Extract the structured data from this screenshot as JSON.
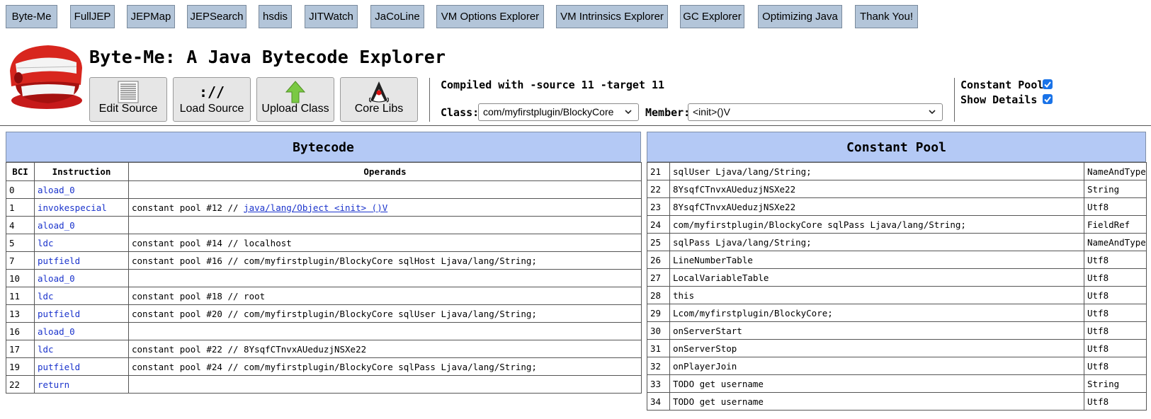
{
  "nav": {
    "items": [
      "Byte-Me",
      "FullJEP",
      "JEPMap",
      "JEPSearch",
      "hsdis",
      "JITWatch",
      "JaCoLine",
      "VM Options Explorer",
      "VM Intrinsics Explorer",
      "GC Explorer",
      "Optimizing Java",
      "Thank You!"
    ]
  },
  "header": {
    "title": "Byte-Me: A Java Bytecode Explorer",
    "logo_icon": "chattering-teeth-icon"
  },
  "toolbar": {
    "edit_source": "Edit Source",
    "load_source": "Load Source",
    "load_source_glyph": "://",
    "upload_class": "Upload Class",
    "core_libs": "Core Libs"
  },
  "compile": {
    "info": "Compiled with -source 11 -target 11",
    "class_label": "Class:",
    "class_value": "com/myfirstplugin/BlockyCore",
    "member_label": "Member:",
    "member_value": "<init>()V"
  },
  "options": {
    "constant_pool_label": "Constant Pool",
    "constant_pool_checked": true,
    "show_details_label": "Show Details",
    "show_details_checked": true
  },
  "bytecode": {
    "title": "Bytecode",
    "columns": [
      "BCI",
      "Instruction",
      "Operands"
    ],
    "rows": [
      {
        "bci": "0",
        "instruction": "aload_0",
        "operand_prefix": "",
        "operand_link": ""
      },
      {
        "bci": "1",
        "instruction": "invokespecial",
        "operand_prefix": "constant pool #12 // ",
        "operand_link": "java/lang/Object <init> ()V"
      },
      {
        "bci": "4",
        "instruction": "aload_0",
        "operand_prefix": "",
        "operand_link": ""
      },
      {
        "bci": "5",
        "instruction": "ldc",
        "operand_prefix": "constant pool #14 // localhost",
        "operand_link": ""
      },
      {
        "bci": "7",
        "instruction": "putfield",
        "operand_prefix": "constant pool #16 // com/myfirstplugin/BlockyCore sqlHost Ljava/lang/String;",
        "operand_link": ""
      },
      {
        "bci": "10",
        "instruction": "aload_0",
        "operand_prefix": "",
        "operand_link": ""
      },
      {
        "bci": "11",
        "instruction": "ldc",
        "operand_prefix": "constant pool #18 // root",
        "operand_link": ""
      },
      {
        "bci": "13",
        "instruction": "putfield",
        "operand_prefix": "constant pool #20 // com/myfirstplugin/BlockyCore sqlUser Ljava/lang/String;",
        "operand_link": ""
      },
      {
        "bci": "16",
        "instruction": "aload_0",
        "operand_prefix": "",
        "operand_link": ""
      },
      {
        "bci": "17",
        "instruction": "ldc",
        "operand_prefix": "constant pool #22 // 8YsqfCTnvxAUeduzjNSXe22",
        "operand_link": ""
      },
      {
        "bci": "19",
        "instruction": "putfield",
        "operand_prefix": "constant pool #24 // com/myfirstplugin/BlockyCore sqlPass Ljava/lang/String;",
        "operand_link": ""
      },
      {
        "bci": "22",
        "instruction": "return",
        "operand_prefix": "",
        "operand_link": ""
      }
    ]
  },
  "constant_pool": {
    "title": "Constant Pool",
    "rows": [
      {
        "index": "21",
        "value": "sqlUser Ljava/lang/String;",
        "type": "NameAndType"
      },
      {
        "index": "22",
        "value": "8YsqfCTnvxAUeduzjNSXe22",
        "type": "String"
      },
      {
        "index": "23",
        "value": "8YsqfCTnvxAUeduzjNSXe22",
        "type": "Utf8"
      },
      {
        "index": "24",
        "value": "com/myfirstplugin/BlockyCore sqlPass Ljava/lang/String;",
        "type": "FieldRef"
      },
      {
        "index": "25",
        "value": "sqlPass Ljava/lang/String;",
        "type": "NameAndType"
      },
      {
        "index": "26",
        "value": "LineNumberTable",
        "type": "Utf8"
      },
      {
        "index": "27",
        "value": "LocalVariableTable",
        "type": "Utf8"
      },
      {
        "index": "28",
        "value": "this",
        "type": "Utf8"
      },
      {
        "index": "29",
        "value": "Lcom/myfirstplugin/BlockyCore;",
        "type": "Utf8"
      },
      {
        "index": "30",
        "value": "onServerStart",
        "type": "Utf8"
      },
      {
        "index": "31",
        "value": "onServerStop",
        "type": "Utf8"
      },
      {
        "index": "32",
        "value": "onPlayerJoin",
        "type": "Utf8"
      },
      {
        "index": "33",
        "value": "TODO get username",
        "type": "String"
      },
      {
        "index": "34",
        "value": "TODO get username",
        "type": "Utf8"
      }
    ]
  },
  "colors": {
    "nav_button": "#b3c5d9",
    "panel_header": "#b4c9f5",
    "instruction_link": "#1a33cc",
    "checkbox": "#1a73e8"
  }
}
